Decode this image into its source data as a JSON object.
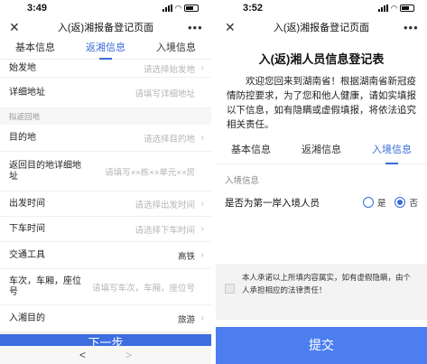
{
  "left": {
    "status_time": "3:49",
    "title": "入(返)湘报备登记页面",
    "tabs": [
      "基本信息",
      "返湘信息",
      "入境信息"
    ],
    "active_tab": 1,
    "rows_top": [
      {
        "label": "始发地",
        "value": "请选择始发地",
        "filled": false
      },
      {
        "label": "详细地址",
        "value": "请填写详细地址",
        "filled": false
      }
    ],
    "section": "拟返回地",
    "rows_bottom": [
      {
        "label": "目的地",
        "value": "请选择目的地",
        "filled": false
      },
      {
        "label": "返回目的地详细地址",
        "value": "请填写××栋××单元××房",
        "filled": false
      },
      {
        "label": "出发时间",
        "value": "请选择出发时间",
        "filled": false
      },
      {
        "label": "下车时间",
        "value": "请选择下车时间",
        "filled": false
      },
      {
        "label": "交通工具",
        "value": "高铁",
        "filled": true
      },
      {
        "label": "车次，车厢，座位号",
        "value": "请填写车次，车厢，座位号",
        "filled": false
      },
      {
        "label": "入湘目的",
        "value": "旅游",
        "filled": true
      }
    ],
    "next_button": "下一步",
    "nav_back": "<",
    "nav_forward": ">"
  },
  "right": {
    "status_time": "3:52",
    "title": "入(返)湘报备登记页面",
    "form_title": "入(返)湘人员信息登记表",
    "intro": "欢迎您回来到湖南省！根据湖南省新冠疫情防控要求，为了您和他人健康，请如实填报以下信息，如有隐瞒或虚假填报，将依法追究相关责任。",
    "tabs": [
      "基本信息",
      "返湘信息",
      "入境信息"
    ],
    "active_tab": 2,
    "section": "入境信息",
    "question": "是否为第一岸入境人员",
    "option_yes": "是",
    "option_no": "否",
    "selected": "否",
    "promise": "本人承诺以上所填内容属实，如有虚假隐瞒，由个人承担相应的法律责任！",
    "submit_button": "提交"
  }
}
